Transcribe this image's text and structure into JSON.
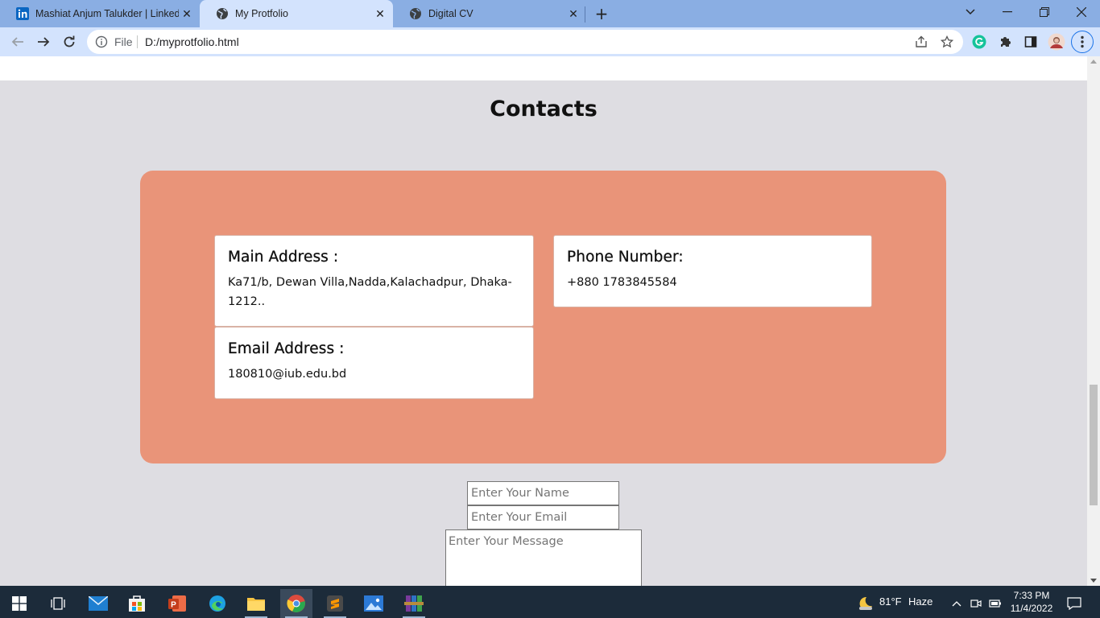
{
  "browser": {
    "tabs": [
      {
        "title": "Mashiat Anjum Talukder | LinkedIn",
        "icon": "linkedin-icon",
        "active": false
      },
      {
        "title": "My Protfolio",
        "icon": "globe-icon",
        "active": true
      },
      {
        "title": "Digital CV",
        "icon": "globe-icon",
        "active": false
      }
    ],
    "omnibox": {
      "scheme_label": "File",
      "url": "D:/myprotfolio.html"
    }
  },
  "page": {
    "section_title": "Contacts",
    "cards": {
      "address": {
        "heading": "Main Address :",
        "text": "Ka71/b, Dewan Villa,Nadda,Kalachadpur, Dhaka-1212.."
      },
      "email": {
        "heading": "Email Address :",
        "text": "180810@iub.edu.bd"
      },
      "phone": {
        "heading": "Phone Number:",
        "text": "+880 1783845584"
      }
    },
    "form": {
      "name_placeholder": "Enter Your Name",
      "email_placeholder": "Enter Your Email",
      "message_placeholder": "Enter Your Message"
    }
  },
  "taskbar": {
    "weather": {
      "temp": "81°F",
      "condition": "Haze"
    },
    "clock": {
      "time": "7:33 PM",
      "date": "11/4/2022"
    }
  },
  "colors": {
    "panel": "#e99479",
    "page_bg": "#dedde2",
    "tabstrip": "#8aaee3",
    "active_tab": "#d3e3fd",
    "taskbar": "#1c2b3a"
  }
}
